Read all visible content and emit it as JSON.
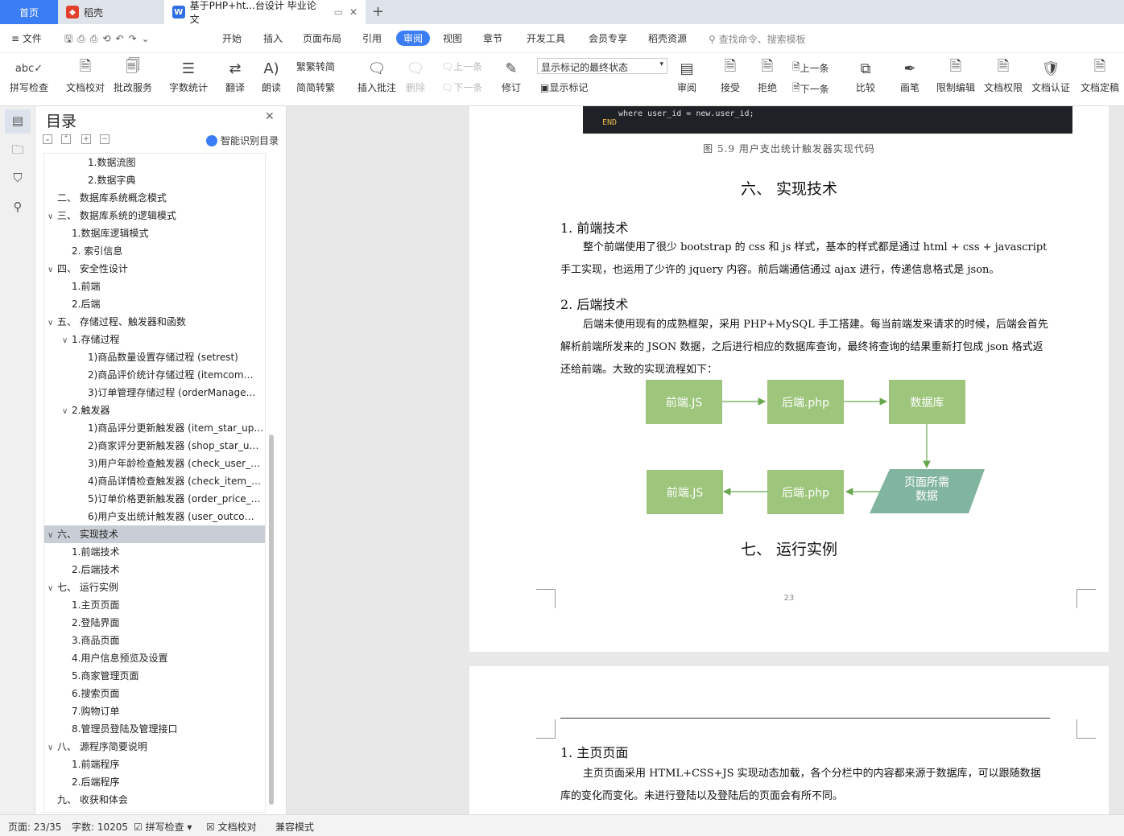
{
  "tabs": {
    "home": "首页",
    "daoke": "稻壳",
    "doc": "基于PHP+ht...台设计 毕业论文"
  },
  "menu": {
    "file": "文件",
    "items": [
      "开始",
      "插入",
      "页面布局",
      "引用",
      "审阅",
      "视图",
      "章节",
      "开发工具",
      "会员专享",
      "稻壳资源"
    ],
    "search": "查找命令、搜索模板"
  },
  "ribbon": {
    "spell": "拼写检查",
    "proof": "文档校对",
    "batch": "批改服务",
    "wordcount": "字数统计",
    "translate": "翻译",
    "read": "朗读",
    "trad": "繁转简",
    "simp": "简转繁",
    "insert_comment": "插入批注",
    "delete": "删除",
    "prev": "上一条",
    "next": "下一条",
    "revise": "修订",
    "markup_select": "显示标记的最终状态",
    "show_markup": "显示标记",
    "review": "审阅",
    "accept": "接受",
    "reject": "拒绝",
    "prev2": "上一条",
    "next2": "下一条",
    "compare": "比较",
    "pen": "画笔",
    "restrict": "限制编辑",
    "perm": "文档权限",
    "cert": "文档认证",
    "final": "文档定稿"
  },
  "toc": {
    "title": "目录",
    "smart": "智能识别目录",
    "items": [
      {
        "text": "1.数据流图",
        "indent": 3,
        "chev": ""
      },
      {
        "text": "2.数据字典",
        "indent": 3,
        "chev": ""
      },
      {
        "text": "二、 数据库系统概念模式",
        "indent": 1,
        "chev": ""
      },
      {
        "text": "三、 数据库系统的逻辑模式",
        "indent": 1,
        "chev": "∨"
      },
      {
        "text": "1.数据库逻辑模式",
        "indent": 2,
        "chev": ""
      },
      {
        "text": "2. 索引信息",
        "indent": 2,
        "chev": ""
      },
      {
        "text": "四、 安全性设计",
        "indent": 1,
        "chev": "∨"
      },
      {
        "text": "1.前端",
        "indent": 2,
        "chev": ""
      },
      {
        "text": "2.后端",
        "indent": 2,
        "chev": ""
      },
      {
        "text": "五、 存储过程、触发器和函数",
        "indent": 1,
        "chev": "∨"
      },
      {
        "text": "1.存储过程",
        "indent": 2,
        "chev": "∨"
      },
      {
        "text": "1)商品数量设置存储过程 (setrest)",
        "indent": 3,
        "chev": ""
      },
      {
        "text": "2)商品评价统计存储过程 (itemcom…",
        "indent": 3,
        "chev": ""
      },
      {
        "text": "3)订单管理存储过程 (orderManage…",
        "indent": 3,
        "chev": ""
      },
      {
        "text": "2.触发器",
        "indent": 2,
        "chev": "∨"
      },
      {
        "text": "1)商品评分更新触发器 (item_star_up…",
        "indent": 3,
        "chev": ""
      },
      {
        "text": "2)商家评分更新触发器 (shop_star_u…",
        "indent": 3,
        "chev": ""
      },
      {
        "text": "3)用户年龄检查触发器 (check_user_…",
        "indent": 3,
        "chev": ""
      },
      {
        "text": "4)商品详情检查触发器 (check_item_…",
        "indent": 3,
        "chev": ""
      },
      {
        "text": "5)订单价格更新触发器 (order_price_…",
        "indent": 3,
        "chev": ""
      },
      {
        "text": "6)用户支出统计触发器 (user_outco…",
        "indent": 3,
        "chev": ""
      },
      {
        "text": "六、 实现技术",
        "indent": 1,
        "chev": "∨",
        "sel": true
      },
      {
        "text": "1.前端技术",
        "indent": 2,
        "chev": ""
      },
      {
        "text": "2.后端技术",
        "indent": 2,
        "chev": ""
      },
      {
        "text": "七、 运行实例",
        "indent": 1,
        "chev": "∨"
      },
      {
        "text": "1.主页页面",
        "indent": 2,
        "chev": ""
      },
      {
        "text": "2.登陆界面",
        "indent": 2,
        "chev": ""
      },
      {
        "text": "3.商品页面",
        "indent": 2,
        "chev": ""
      },
      {
        "text": "4.用户信息预览及设置",
        "indent": 2,
        "chev": ""
      },
      {
        "text": "5.商家管理页面",
        "indent": 2,
        "chev": ""
      },
      {
        "text": "6.搜索页面",
        "indent": 2,
        "chev": ""
      },
      {
        "text": "7.购物订单",
        "indent": 2,
        "chev": ""
      },
      {
        "text": "8.管理员登陆及管理接口",
        "indent": 2,
        "chev": ""
      },
      {
        "text": "八、 源程序简要说明",
        "indent": 1,
        "chev": "∨"
      },
      {
        "text": "1.前端程序",
        "indent": 2,
        "chev": ""
      },
      {
        "text": "2.后端程序",
        "indent": 2,
        "chev": ""
      },
      {
        "text": "九、 收获和体会",
        "indent": 1,
        "chev": ""
      }
    ]
  },
  "doc": {
    "code_line1": "where user_id = new.user_id;",
    "code_line2": "END",
    "fig_caption": "图 5.9 用户支出统计触发器实现代码",
    "h_six": "六、 实现技术",
    "h_front": "1. 前端技术",
    "p_front": "整个前端使用了很少 bootstrap 的 css 和 js 样式，基本的样式都是通过 html + css + javascript 手工实现，也运用了少许的 jquery 内容。前后端通信通过 ajax 进行，传递信息格式是 json。",
    "h_back": "2. 后端技术",
    "p_back": "后端未使用现有的成熟框架，采用 PHP+MySQL 手工搭建。每当前端发来请求的时候，后端会首先解析前端所发来的 JSON 数据，之后进行相应的数据库查询，最终将查询的结果重新打包成 json 格式返还给前端。大致的实现流程如下：",
    "flow": {
      "a1": "前端.JS",
      "a2": "后端.php",
      "a3": "数据库",
      "b1": "前端.JS",
      "b2": "后端.php",
      "b3": "页面所需\n数据"
    },
    "h_seven": "七、 运行实例",
    "page_num": "23",
    "h_home": "1. 主页页面",
    "p_home": "主页页面采用 HTML+CSS+JS 实现动态加载，各个分栏中的内容都来源于数据库，可以跟随数据库的变化而变化。未进行登陆以及登陆后的页面会有所不同。"
  },
  "status": {
    "page": "页面: 23/35",
    "words": "字数: 10205",
    "spell": "拼写检查",
    "proof": "文档校对",
    "compat": "兼容模式"
  }
}
